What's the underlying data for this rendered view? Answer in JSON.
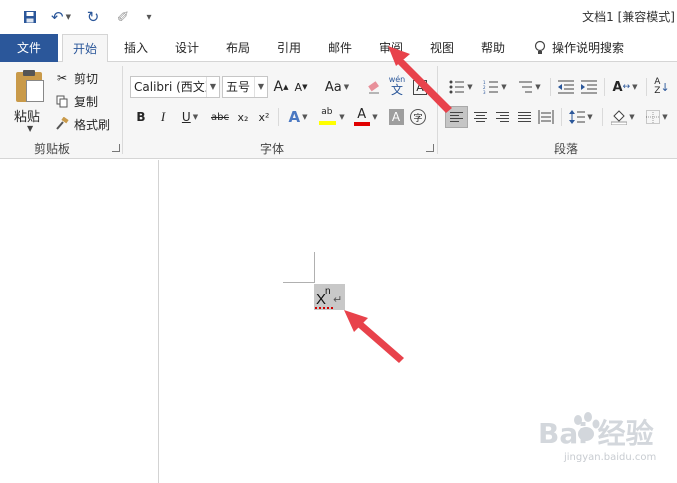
{
  "window": {
    "title": "文档1 [兼容模式]"
  },
  "tabs": {
    "file": "文件",
    "home": "开始",
    "insert": "插入",
    "design": "设计",
    "layout": "布局",
    "references": "引用",
    "mailings": "邮件",
    "review": "审阅",
    "view": "视图",
    "help": "帮助",
    "tell_me": "操作说明搜索"
  },
  "clipboard": {
    "paste": "粘贴",
    "cut": "剪切",
    "copy": "复制",
    "format_painter": "格式刷",
    "group_label": "剪贴板"
  },
  "font": {
    "font_name": "Calibri (西文正文)",
    "font_size": "五号",
    "group_label": "字体",
    "bold": "B",
    "italic": "I",
    "underline": "U",
    "strikethrough": "abc",
    "subscript": "x₂",
    "superscript": "x²",
    "grow": "A",
    "shrink": "A",
    "change_case": "Aa",
    "phonetic_top": "wén",
    "phonetic_bottom": "文",
    "font_color": "A",
    "char_shading": "A",
    "enclose": "字",
    "highlight_label": "ab",
    "highlight_color": "#ffff00",
    "font_color_value": "#e00000"
  },
  "paragraph": {
    "group_label": "段落"
  },
  "document": {
    "base_char": "X",
    "superscript_char": "n",
    "paragraph_mark": "↵"
  },
  "watermark": {
    "main": "Bai 经验",
    "sub": "jingyan.baidu.com"
  },
  "colors": {
    "accent": "#2b579a",
    "annotation_arrow": "#e8424b"
  }
}
